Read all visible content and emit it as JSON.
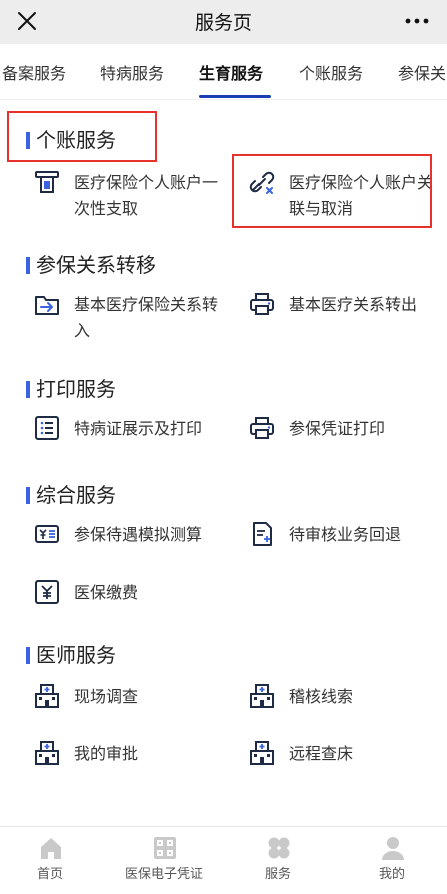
{
  "navbar": {
    "title": "服务页"
  },
  "tabs": [
    {
      "label": "备案服务"
    },
    {
      "label": "特病服务"
    },
    {
      "label": "生育服务",
      "active": true
    },
    {
      "label": "个账服务"
    },
    {
      "label": "参保关"
    }
  ],
  "sections": [
    {
      "title": "个账服务",
      "items": [
        {
          "label": "医疗保险个人账户一次性支取",
          "icon": "withdraw-icon"
        },
        {
          "label": "医疗保险个人账户关联与取消",
          "icon": "link-cancel-icon"
        }
      ]
    },
    {
      "title": "参保关系转移",
      "items": [
        {
          "label": "基本医疗保险关系转入",
          "icon": "transfer-in-icon"
        },
        {
          "label": "基本医疗关系转出",
          "icon": "printer-icon"
        }
      ]
    },
    {
      "title": "打印服务",
      "items": [
        {
          "label": "特病证展示及打印",
          "icon": "list-icon"
        },
        {
          "label": "参保凭证打印",
          "icon": "printer-icon"
        }
      ]
    },
    {
      "title": "综合服务",
      "items": [
        {
          "label": "参保待遇模拟测算",
          "icon": "yuan-card-icon"
        },
        {
          "label": "待审核业务回退",
          "icon": "document-icon"
        },
        {
          "label": "医保缴费",
          "icon": "yuan-box-icon"
        }
      ]
    },
    {
      "title": "医师服务",
      "items": [
        {
          "label": "现场调查",
          "icon": "hospital-icon"
        },
        {
          "label": "稽核线索",
          "icon": "hospital-icon"
        },
        {
          "label": "我的审批",
          "icon": "hospital-icon"
        },
        {
          "label": "远程查床",
          "icon": "hospital-icon"
        }
      ]
    }
  ],
  "tabbar": [
    {
      "label": "首页",
      "icon": "home-icon"
    },
    {
      "label": "医保电子凭证",
      "icon": "qr-code-icon"
    },
    {
      "label": "服务",
      "icon": "services-icon"
    },
    {
      "label": "我的",
      "icon": "user-icon"
    }
  ],
  "colors": {
    "accent": "#1a3db4",
    "section_bar": "#3a63e0",
    "highlight_box": "#e6312d",
    "icon": "#1f2a44"
  }
}
